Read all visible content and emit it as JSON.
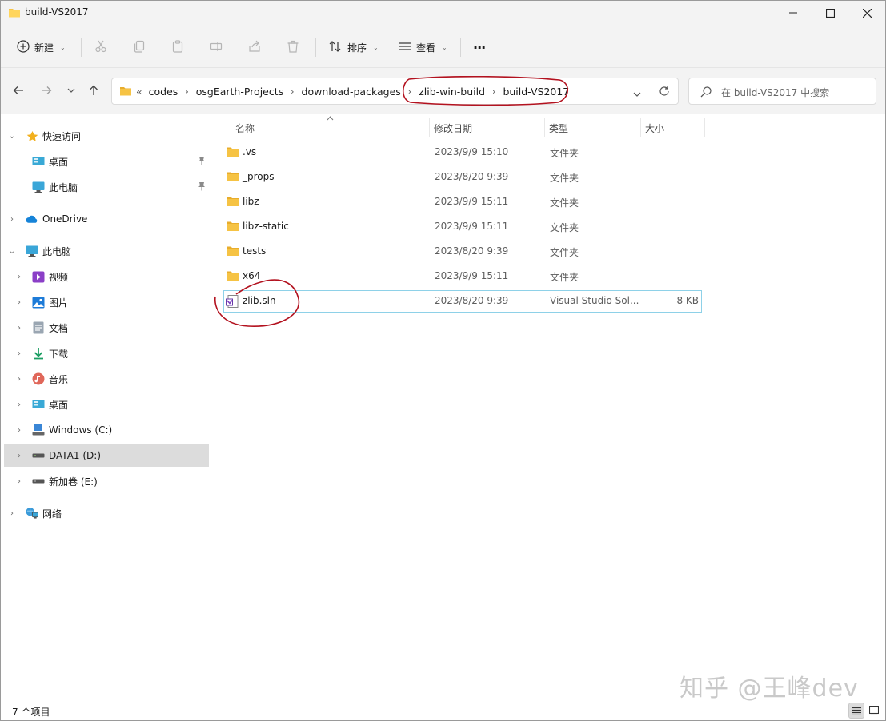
{
  "window": {
    "title": "build-VS2017"
  },
  "toolbar": {
    "new_label": "新建",
    "sort_label": "排序",
    "view_label": "查看",
    "more_label": "···"
  },
  "address": {
    "overflow": "«",
    "crumbs": [
      "codes",
      "osgEarth-Projects",
      "download-packages",
      "zlib-win-build",
      "build-VS2017"
    ]
  },
  "search": {
    "placeholder": "在 build-VS2017 中搜索"
  },
  "sidebar": {
    "items": [
      {
        "label": "快速访问",
        "icon": "star-icon"
      },
      {
        "label": "桌面",
        "icon": "desktop-icon"
      },
      {
        "label": "此电脑",
        "icon": "computer-icon"
      },
      {
        "label": "OneDrive",
        "icon": "cloud-icon"
      },
      {
        "label": "此电脑",
        "icon": "computer-icon"
      },
      {
        "label": "视频",
        "icon": "video-icon"
      },
      {
        "label": "图片",
        "icon": "pictures-icon"
      },
      {
        "label": "文档",
        "icon": "documents-icon"
      },
      {
        "label": "下载",
        "icon": "download-icon"
      },
      {
        "label": "音乐",
        "icon": "music-icon"
      },
      {
        "label": "桌面",
        "icon": "desktop-icon"
      },
      {
        "label": "Windows (C:)",
        "icon": "windows-drive-icon"
      },
      {
        "label": "DATA1 (D:)",
        "icon": "drive-icon"
      },
      {
        "label": "新加卷 (E:)",
        "icon": "drive-icon"
      },
      {
        "label": "网络",
        "icon": "network-icon"
      }
    ]
  },
  "columns": {
    "name": "名称",
    "modified": "修改日期",
    "type": "类型",
    "size": "大小"
  },
  "files": [
    {
      "name": ".vs",
      "modified": "2023/9/9 15:10",
      "type": "文件夹",
      "size": "",
      "icon": "folder-icon"
    },
    {
      "name": "_props",
      "modified": "2023/8/20 9:39",
      "type": "文件夹",
      "size": "",
      "icon": "folder-icon"
    },
    {
      "name": "libz",
      "modified": "2023/9/9 15:11",
      "type": "文件夹",
      "size": "",
      "icon": "folder-icon"
    },
    {
      "name": "libz-static",
      "modified": "2023/9/9 15:11",
      "type": "文件夹",
      "size": "",
      "icon": "folder-icon"
    },
    {
      "name": "tests",
      "modified": "2023/8/20 9:39",
      "type": "文件夹",
      "size": "",
      "icon": "folder-icon"
    },
    {
      "name": "x64",
      "modified": "2023/9/9 15:11",
      "type": "文件夹",
      "size": "",
      "icon": "folder-icon"
    },
    {
      "name": "zlib.sln",
      "modified": "2023/8/20 9:39",
      "type": "Visual Studio Sol...",
      "size": "8 KB",
      "icon": "vs-solution-icon"
    }
  ],
  "status": {
    "count": "7 个项目"
  },
  "watermark": "知乎 @王峰dev",
  "colors": {
    "folder": "#f6c344",
    "annotation": "#b3121f",
    "selection": "#8ed1e8"
  }
}
